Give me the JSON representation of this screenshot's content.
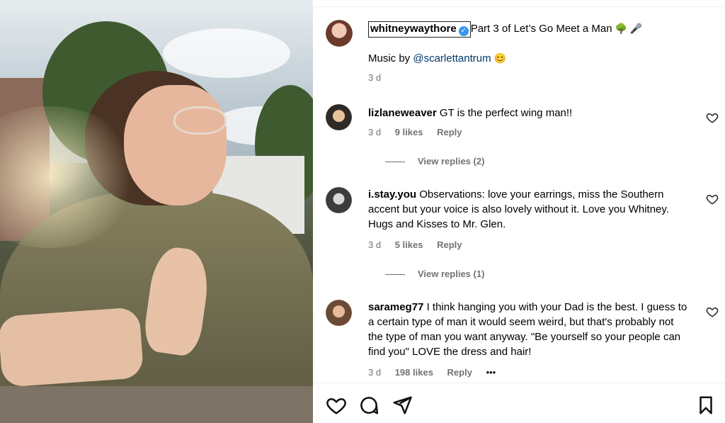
{
  "post": {
    "author": "whitneywaythore",
    "caption": "Part 3 of Let’s Go Meet a Man",
    "caption_emojis": "🌳 🎤",
    "music_prefix": "Music by ",
    "music_handle": "@scarlettantrum",
    "music_emoji": "😊",
    "time": "3 d"
  },
  "comments": [
    {
      "username": "lizlaneweaver",
      "text": "GT is the perfect wing man!!",
      "time": "3 d",
      "likes": "9 likes",
      "reply": "Reply",
      "view_replies": "View replies (2)"
    },
    {
      "username": "i.stay.you",
      "text": "Observations: love your earrings, miss the Southern accent but your voice is also lovely without it. Love you Whitney. Hugs and Kisses to Mr. Glen.",
      "time": "3 d",
      "likes": "5 likes",
      "reply": "Reply",
      "view_replies": "View replies (1)"
    },
    {
      "username": "sarameg77",
      "text": "I think hanging you with your Dad is the best. I guess to a certain type of man it would seem weird, but that's probably not the type of man you want anyway. \"Be yourself so your people can find you\" LOVE the dress and hair!",
      "time": "3 d",
      "likes": "198 likes",
      "reply": "Reply",
      "more": "•••"
    }
  ],
  "icons": {
    "verified": "verified-badge-icon",
    "like": "heart-icon",
    "comment": "comment-icon",
    "share": "share-icon",
    "save": "bookmark-icon"
  },
  "colors": {
    "verified": "#3897f0",
    "link": "#00376b",
    "secondary_text": "#737373"
  }
}
